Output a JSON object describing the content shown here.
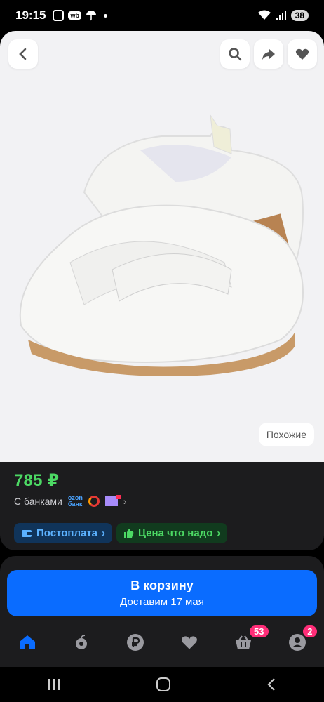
{
  "status": {
    "time": "19:15",
    "wb_label": "wb",
    "battery": "38"
  },
  "product": {
    "price": "785 ₽",
    "banks_label": "С банками",
    "ozon_top": "ozon",
    "ozon_bottom": "банк",
    "similar_label": "Похожие",
    "pills": [
      {
        "label": "Постоплата",
        "color": "#5cb2ff"
      },
      {
        "label": "Цена что надо",
        "color": "#4cd964"
      }
    ]
  },
  "cart": {
    "title": "В корзину",
    "subtitle": "Доставим 17 мая"
  },
  "tabs": {
    "cart_badge": "53",
    "profile_badge": "2"
  },
  "colors": {
    "accent": "#0a6cff",
    "price": "#4cd964",
    "badge": "#ff2d78"
  }
}
